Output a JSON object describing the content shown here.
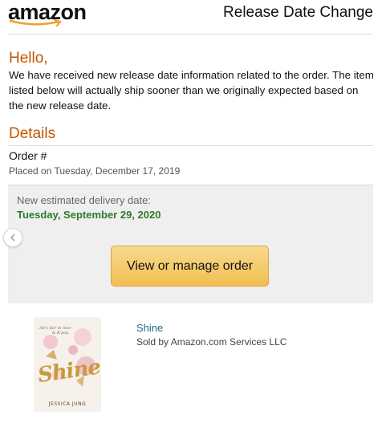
{
  "header": {
    "logo_text": "amazon",
    "title": "Release Date Change"
  },
  "message": {
    "greeting": "Hello,",
    "body": "We have received new release date information related to the order. The item listed below will actually ship sooner than we originally expected based on the new release date."
  },
  "details": {
    "heading": "Details",
    "order_label": "Order #",
    "placed_on": "Placed on Tuesday, December 17, 2019"
  },
  "delivery": {
    "label": "New estimated delivery date:",
    "date": "Tuesday, September 29, 2020"
  },
  "actions": {
    "manage_order_label": "View or manage order"
  },
  "product": {
    "title": "Shine",
    "seller": "Sold by Amazon.com Services LLC",
    "cover": {
      "title": "Shine",
      "author": "JESSICA JUNG"
    }
  },
  "colors": {
    "accent_orange": "#c45500",
    "delivery_green": "#2c7a2c",
    "button_yellow": "#f1bf52",
    "link_blue": "#1f6b8a"
  },
  "icons": {
    "carousel_prev": "chevron-left-icon",
    "logo_smile": "amazon-smile-icon"
  }
}
